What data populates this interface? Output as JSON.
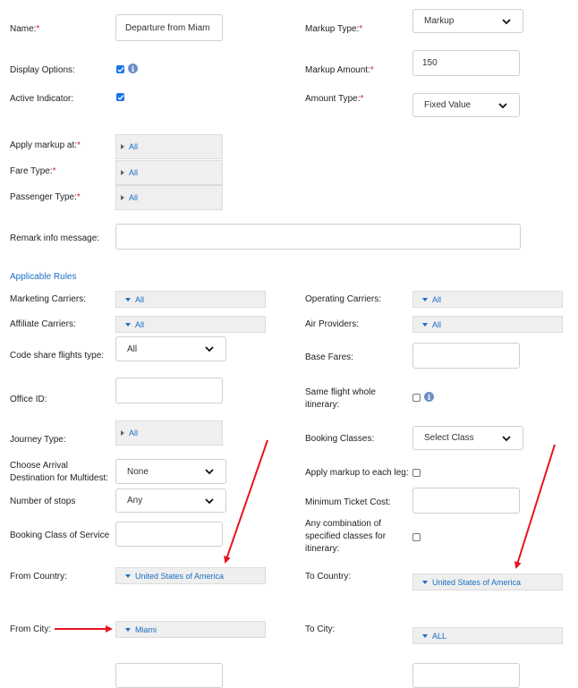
{
  "form": {
    "name_label": "Name:",
    "name_value": "Departure from Miam",
    "markup_type_label": "Markup Type:",
    "markup_type_value": "Markup",
    "display_options_label": "Display Options:",
    "markup_amount_label": "Markup Amount:",
    "markup_amount_value": "150",
    "active_indicator_label": "Active Indicator:",
    "amount_type_label": "Amount Type:",
    "amount_type_value": "Fixed Value",
    "apply_markup_at_label": "Apply markup at:",
    "apply_markup_at_value": "All",
    "fare_type_label": "Fare Type:",
    "fare_type_value": "All",
    "passenger_type_label": "Passenger Type:",
    "passenger_type_value": "All",
    "remark_label": "Remark info message:",
    "remark_value": "",
    "required_mark": "*"
  },
  "rules": {
    "section_title": "Applicable Rules",
    "marketing_carriers_label": "Marketing Carriers:",
    "marketing_carriers_value": "All",
    "operating_carriers_label": "Operating Carriers:",
    "operating_carriers_value": "All",
    "affiliate_carriers_label": "Affiliate Carriers:",
    "affiliate_carriers_value": "All",
    "air_providers_label": "Air Providers:",
    "air_providers_value": "All",
    "code_share_label": "Code share flights type:",
    "code_share_value": "All",
    "base_fares_label": "Base Fares:",
    "office_id_label": "Office ID:",
    "same_flight_label_1": "Same flight whole",
    "same_flight_label_2": "itinerary:",
    "journey_type_label": "Journey Type:",
    "journey_type_value": "All",
    "booking_classes_label": "Booking Classes:",
    "booking_classes_value": "Select Class",
    "arrival_label_1": "Choose Arrival",
    "arrival_label_2": "Destination for Multidest:",
    "arrival_value": "None",
    "each_leg_label": "Apply markup to each leg:",
    "stops_label": "Number of stops",
    "stops_value": "Any",
    "min_ticket_label": "Minimum Ticket Cost:",
    "booking_class_service_label": "Booking Class of Service",
    "any_combination_label_1": "Any combination of",
    "any_combination_label_2": "specified classes for",
    "any_combination_label_3": "itinerary:",
    "from_country_label": "From Country:",
    "from_country_value": "United States of America",
    "to_country_label": "To Country:",
    "to_country_value": "United States of America",
    "from_city_label": "From City:",
    "from_city_value": "Miami",
    "to_city_label": "To City:",
    "to_city_value": "ALL"
  },
  "colors": {
    "accent": "#1b6ec2",
    "required": "#d9242b",
    "arrow": "#e8141c",
    "checkbox": "#1a73e8"
  },
  "icons": [
    "info-icon",
    "check-icon",
    "chevron-down-icon",
    "triangle-right-icon",
    "triangle-down-icon",
    "arrow-annotation"
  ]
}
